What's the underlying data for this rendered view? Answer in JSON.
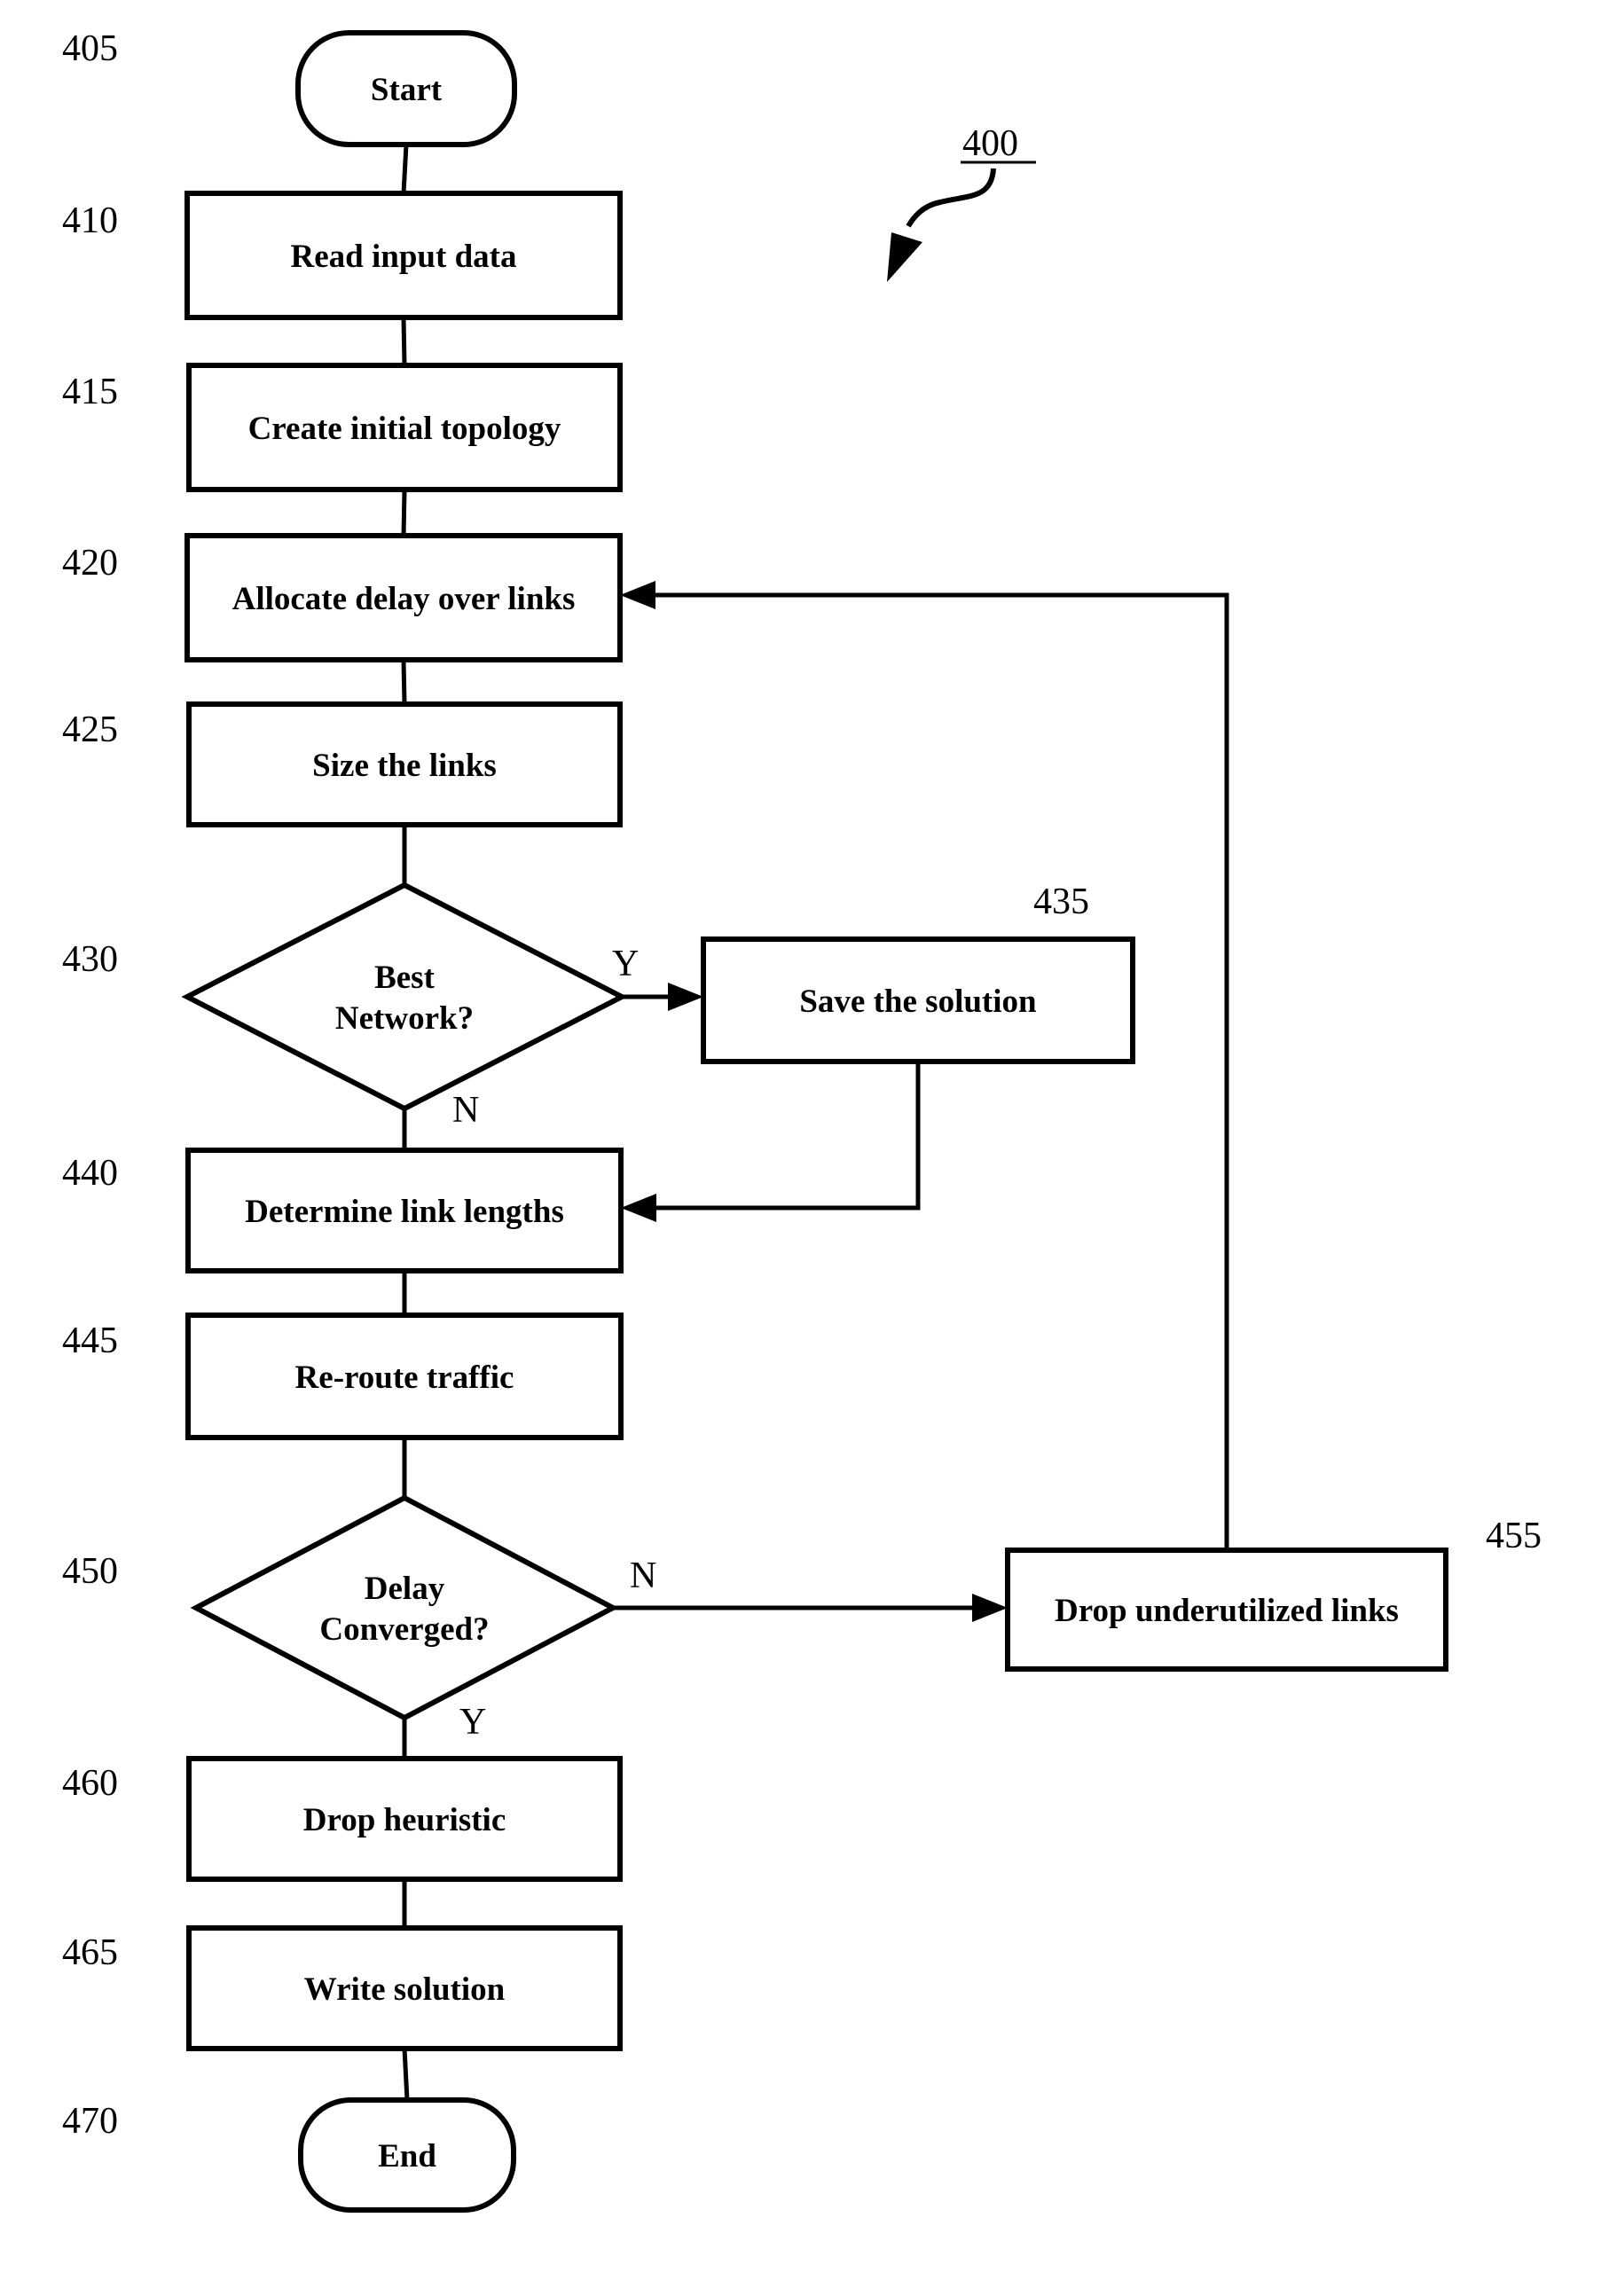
{
  "figure": {
    "number": "400"
  },
  "nodes": [
    {
      "id": "405",
      "type": "terminal",
      "text": [
        "Start"
      ]
    },
    {
      "id": "410",
      "type": "process",
      "text": [
        "Read input data"
      ]
    },
    {
      "id": "415",
      "type": "process",
      "text": [
        "Create initial topology"
      ]
    },
    {
      "id": "420",
      "type": "process",
      "text": [
        "Allocate delay over links"
      ]
    },
    {
      "id": "425",
      "type": "process",
      "text": [
        "Size the links"
      ]
    },
    {
      "id": "430",
      "type": "decision",
      "text": [
        "Best",
        "Network?"
      ]
    },
    {
      "id": "435",
      "type": "process",
      "text": [
        "Save the solution"
      ]
    },
    {
      "id": "440",
      "type": "process",
      "text": [
        "Determine link lengths"
      ]
    },
    {
      "id": "445",
      "type": "process",
      "text": [
        "Re-route traffic"
      ]
    },
    {
      "id": "450",
      "type": "decision",
      "text": [
        "Delay",
        "Converged?"
      ]
    },
    {
      "id": "455",
      "type": "process",
      "text": [
        "Drop underutilized links"
      ]
    },
    {
      "id": "460",
      "type": "process",
      "text": [
        "Drop heuristic"
      ]
    },
    {
      "id": "465",
      "type": "process",
      "text": [
        "Write solution"
      ]
    },
    {
      "id": "470",
      "type": "terminal",
      "text": [
        "End"
      ]
    }
  ],
  "edges": [
    {
      "from": "405",
      "to": "410",
      "label": ""
    },
    {
      "from": "410",
      "to": "415",
      "label": ""
    },
    {
      "from": "415",
      "to": "420",
      "label": ""
    },
    {
      "from": "420",
      "to": "425",
      "label": ""
    },
    {
      "from": "425",
      "to": "430",
      "label": ""
    },
    {
      "from": "430",
      "to": "435",
      "label": "Y"
    },
    {
      "from": "430",
      "to": "440",
      "label": "N"
    },
    {
      "from": "435",
      "to": "440",
      "label": ""
    },
    {
      "from": "440",
      "to": "445",
      "label": ""
    },
    {
      "from": "445",
      "to": "450",
      "label": ""
    },
    {
      "from": "450",
      "to": "455",
      "label": "N"
    },
    {
      "from": "450",
      "to": "460",
      "label": "Y"
    },
    {
      "from": "455",
      "to": "420",
      "label": ""
    },
    {
      "from": "460",
      "to": "465",
      "label": ""
    },
    {
      "from": "465",
      "to": "470",
      "label": ""
    }
  ]
}
